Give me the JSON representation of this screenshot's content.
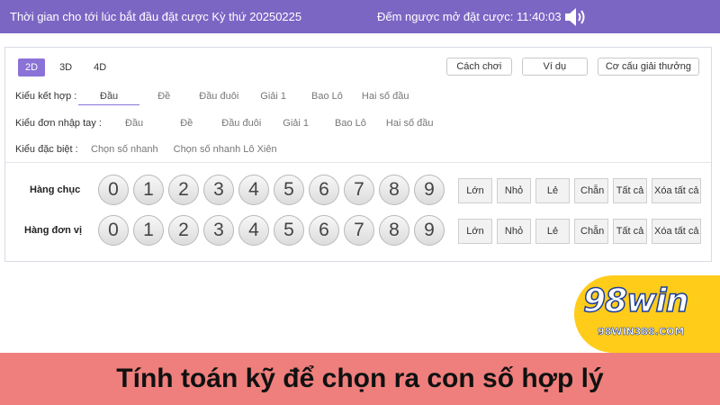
{
  "header": {
    "draw_text": "Thời gian cho tới lúc bắt đầu đặt cược Kỳ thứ 20250225",
    "countdown_text": "Đếm ngược mở đặt cược: 11:40:03",
    "speaker_icon": "speaker-icon"
  },
  "tabs": [
    "2D",
    "3D",
    "4D"
  ],
  "active_tab": "2D",
  "links": [
    "Cách chơi",
    "Ví dụ",
    "Cơ cấu giải thưởng"
  ],
  "bet_types": {
    "combo": {
      "label": "Kiểu kết hợp :",
      "options": [
        "Đầu",
        "Đề",
        "Đầu đuôi",
        "Giải 1",
        "Bao Lô",
        "Hai số đầu"
      ],
      "selected": "Đầu"
    },
    "manual": {
      "label": "Kiểu đơn nhập tay :",
      "options": [
        "Đầu",
        "Đề",
        "Đầu đuôi",
        "Giải 1",
        "Bao Lô",
        "Hai số đầu"
      ]
    },
    "special": {
      "label": "Kiểu đặc biệt :",
      "options": [
        "Chọn số nhanh",
        "Chọn số nhanh Lô Xiên"
      ]
    }
  },
  "digit_rows": [
    {
      "label": "Hàng chục",
      "digits": [
        "0",
        "1",
        "2",
        "3",
        "4",
        "5",
        "6",
        "7",
        "8",
        "9"
      ],
      "quick": [
        "Lớn",
        "Nhỏ",
        "Lẻ",
        "Chẵn",
        "Tất cả",
        "Xóa tất cả"
      ]
    },
    {
      "label": "Hàng đơn vị",
      "digits": [
        "0",
        "1",
        "2",
        "3",
        "4",
        "5",
        "6",
        "7",
        "8",
        "9"
      ],
      "quick": [
        "Lớn",
        "Nhỏ",
        "Lẻ",
        "Chẵn",
        "Tất cả",
        "Xóa tất cả"
      ]
    }
  ],
  "logo": {
    "main": "98win",
    "domain": "98WIN388.COM"
  },
  "banner": {
    "text": "Tính toán kỹ để chọn ra con số hợp lý"
  },
  "colors": {
    "header_bg": "#7b66c4",
    "active_tab": "#8a72d6",
    "banner_bg": "#ef7f7c",
    "logo_bg": "#ffcc1a"
  }
}
